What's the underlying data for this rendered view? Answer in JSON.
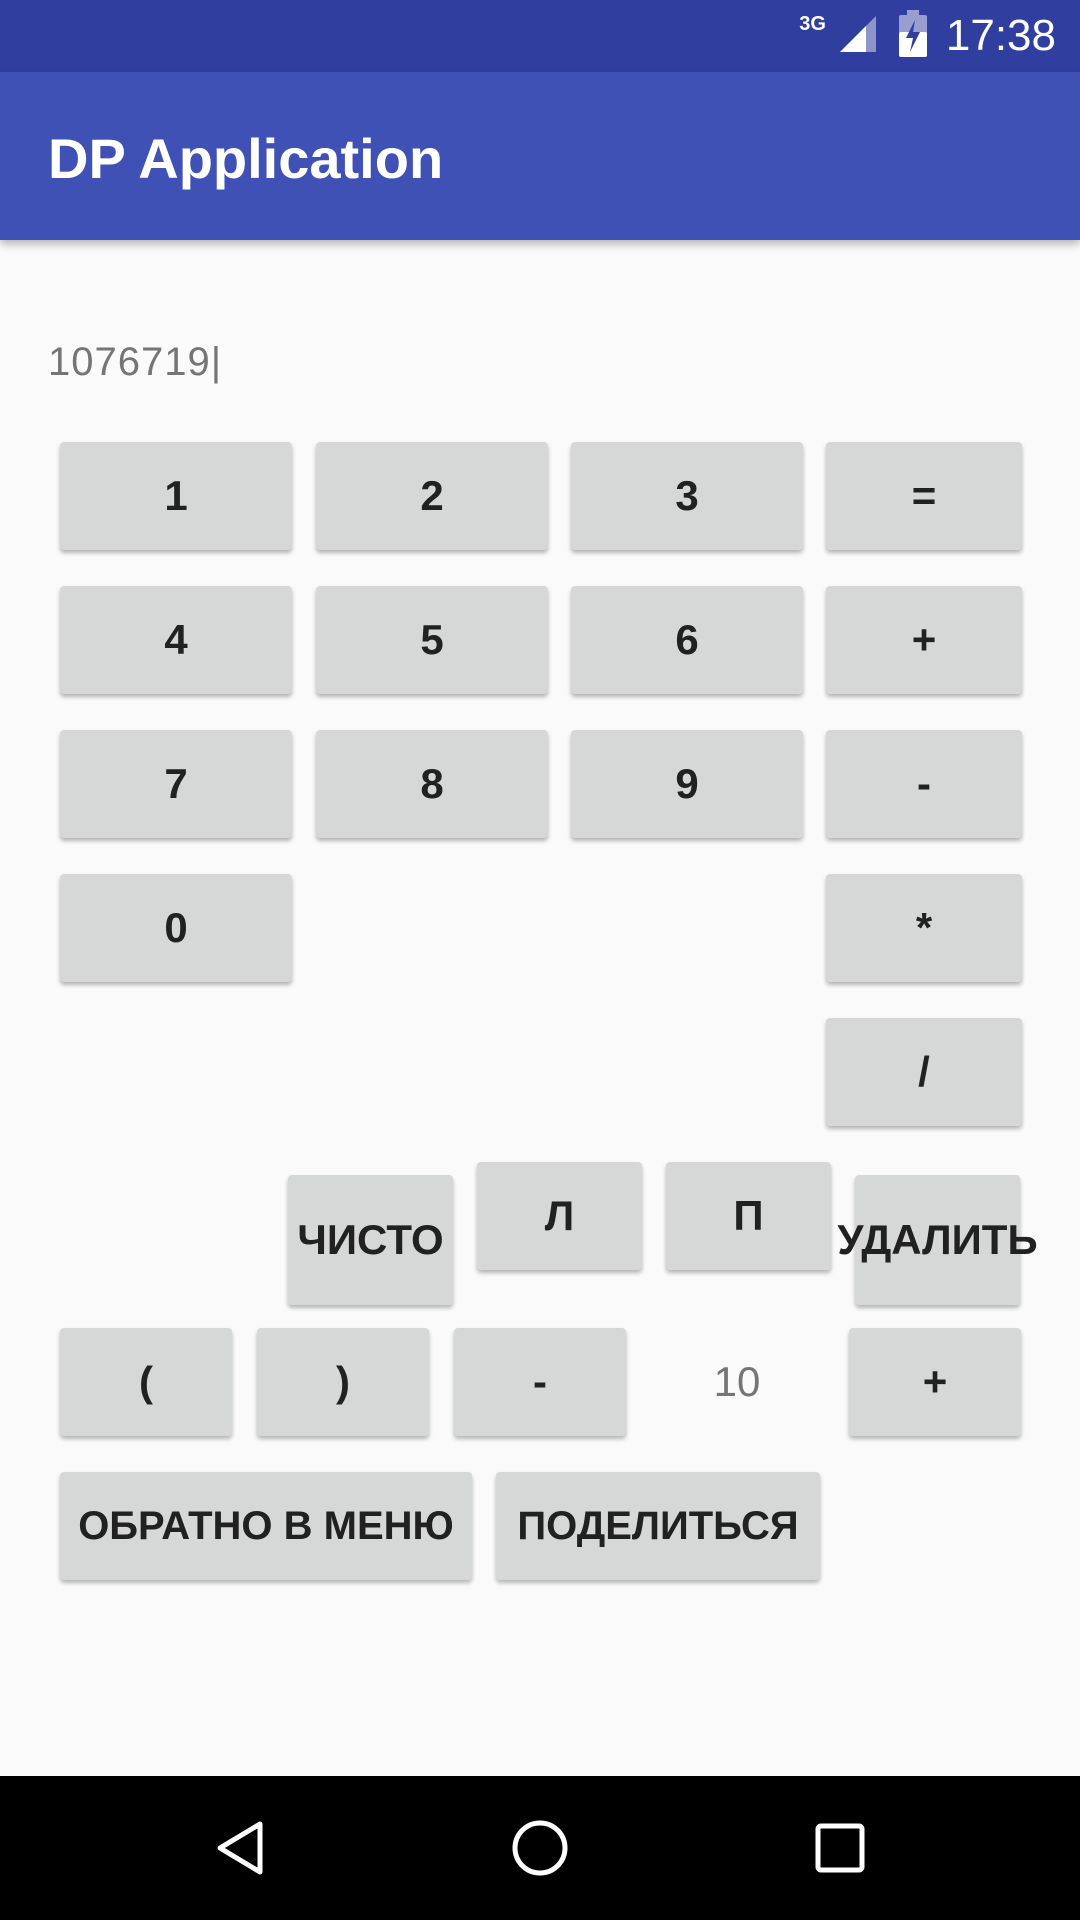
{
  "status_bar": {
    "network": "3G",
    "time": "17:38",
    "icons": [
      "signal-icon",
      "battery-icon"
    ]
  },
  "app_bar": {
    "title": "DP Application"
  },
  "display": {
    "expression": "1076719|"
  },
  "keypad": {
    "k1": "1",
    "k2": "2",
    "k3": "3",
    "eq": "=",
    "k4": "4",
    "k5": "5",
    "k6": "6",
    "plus": "+",
    "k7": "7",
    "k8": "8",
    "k9": "9",
    "minus": "-",
    "k0": "0",
    "mul": "*",
    "div": "/"
  },
  "controls": {
    "clear": "ЧИСТО",
    "left": "Л",
    "right": "П",
    "delete": "УДАЛИТЬ",
    "open_paren": "(",
    "close_paren": ")",
    "decrement": "-",
    "value": "10",
    "increment": "+"
  },
  "footer_buttons": {
    "back_to_menu": "ОБРАТНО В МЕНЮ",
    "share": "ПОДЕЛИТЬСЯ"
  },
  "colors": {
    "status_bar": "#303F9F",
    "app_bar": "#3F51B5",
    "button": "#D6D7D7",
    "background": "#FAFAFA"
  }
}
